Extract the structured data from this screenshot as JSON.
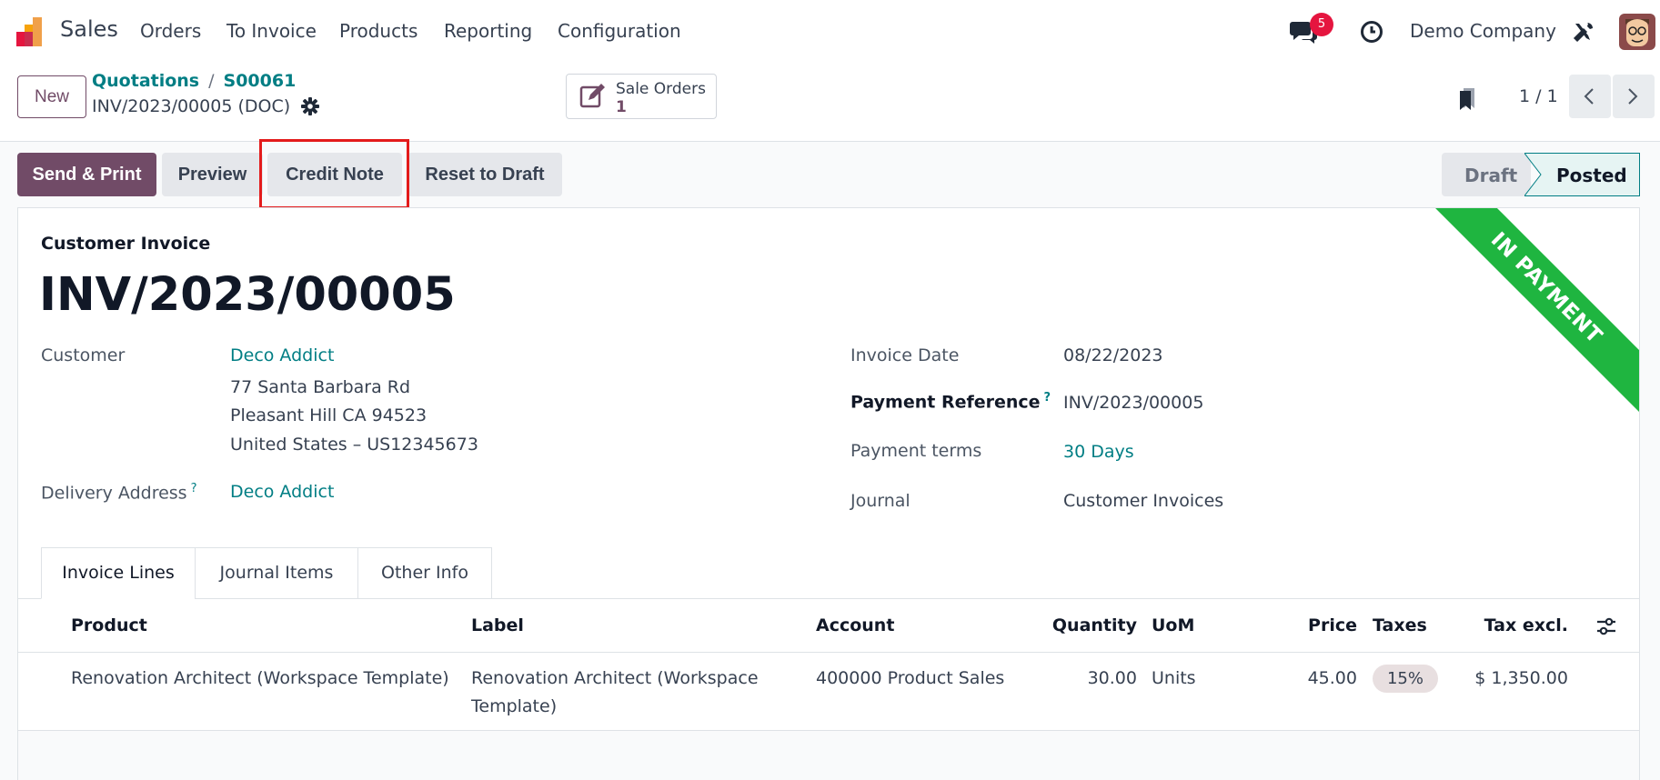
{
  "navbar": {
    "app_name": "Sales",
    "menu": [
      "Orders",
      "To Invoice",
      "Products",
      "Reporting",
      "Configuration"
    ],
    "message_count": "5",
    "company": "Demo Company"
  },
  "control": {
    "new_label": "New",
    "breadcrumb": [
      "Quotations",
      "S00061"
    ],
    "record_name": "INV/2023/00005 (DOC)",
    "smart_button": {
      "label": "Sale Orders",
      "value": "1"
    },
    "pager": "1 / 1"
  },
  "actions": {
    "send_print": "Send & Print",
    "preview": "Preview",
    "credit_note": "Credit Note",
    "reset_to_draft": "Reset to Draft"
  },
  "status": {
    "draft": "Draft",
    "posted": "Posted",
    "current": "Posted"
  },
  "ribbon": "IN PAYMENT",
  "invoice": {
    "type": "Customer Invoice",
    "number": "INV/2023/00005",
    "customer_label": "Customer",
    "customer": "Deco Addict",
    "address": [
      "77 Santa Barbara Rd",
      "Pleasant Hill CA 94523",
      "United States – US12345673"
    ],
    "delivery_label": "Delivery Address",
    "delivery": "Deco Addict",
    "invoice_date_label": "Invoice Date",
    "invoice_date": "08/22/2023",
    "payment_ref_label": "Payment Reference",
    "payment_ref": "INV/2023/00005",
    "payment_terms_label": "Payment terms",
    "payment_terms": "30 Days",
    "journal_label": "Journal",
    "journal": "Customer Invoices",
    "help_mark": "?"
  },
  "tabs": [
    "Invoice Lines",
    "Journal Items",
    "Other Info"
  ],
  "lines": {
    "headers": [
      "Product",
      "Label",
      "Account",
      "Quantity",
      "UoM",
      "Price",
      "Taxes",
      "Tax excl."
    ],
    "rows": [
      {
        "product": "Renovation Architect (Workspace Template)",
        "label_1": "Renovation Architect (Workspace",
        "label_2": "Template)",
        "account": "400000 Product Sales",
        "quantity": "30.00",
        "uom": "Units",
        "price": "45.00",
        "taxes": "15%",
        "subtotal": "$ 1,350.00"
      }
    ]
  },
  "colors": {
    "primary": "#714b67",
    "link": "#017e84",
    "ribbon": "#1fb540",
    "highlight": "#e31b1b",
    "badge": "#e5153f"
  }
}
